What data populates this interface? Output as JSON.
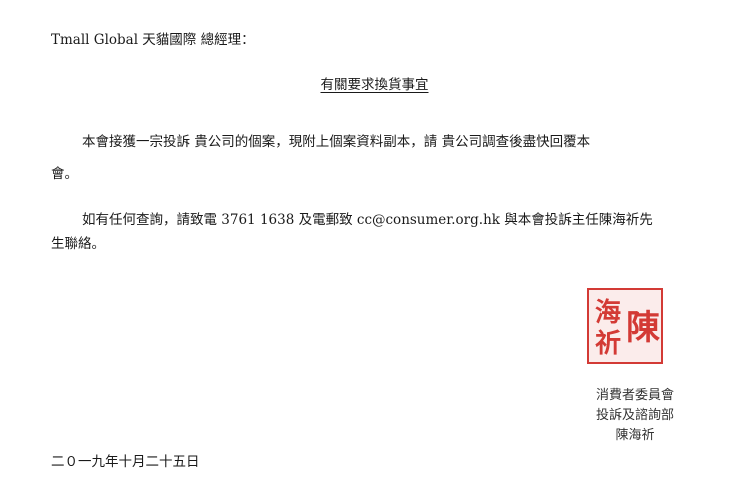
{
  "letter": {
    "salutation": "Tmall Global 天貓國際 總經理：",
    "subject": "有關要求換貨事宜",
    "paragraph1": {
      "line1": "本會接獲一宗投訴 貴公司的個案，現附上個案資料副本，請 貴公司調查後盡快回覆本",
      "line2": "會。"
    },
    "paragraph2": {
      "line1": "如有任何查詢，請致電 3761 1638 及電郵致 cc@consumer.org.hk 與本會投訴主任陳海祈先",
      "line2": "生聯絡。"
    },
    "seal": {
      "characters": [
        "陳",
        "海",
        "祈"
      ],
      "color": "#d33a35"
    },
    "signature": {
      "organization": "消費者委員會",
      "department": "投訴及諮詢部",
      "name": "陳海祈"
    },
    "date": "二０一九年十月二十五日"
  }
}
